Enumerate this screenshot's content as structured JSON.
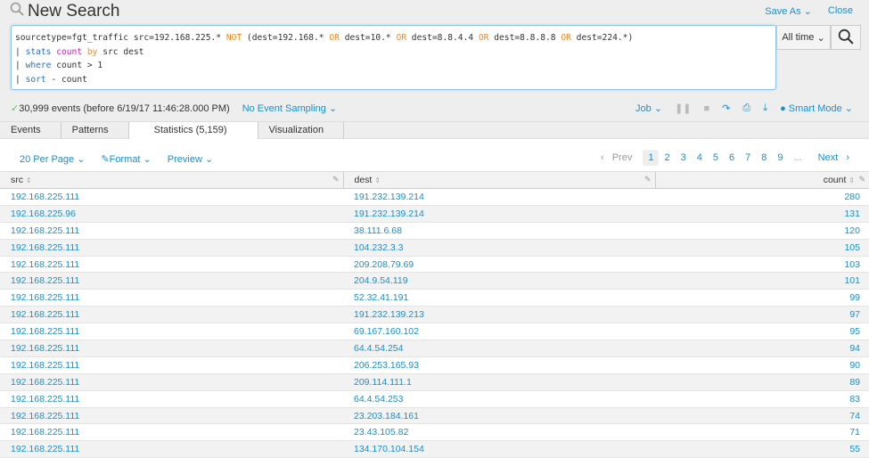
{
  "header": {
    "title": "New Search",
    "save_as": "Save As",
    "close": "Close"
  },
  "search": {
    "line1": {
      "a": "sourcetype=fgt_traffic src=192.168.225.* ",
      "not": "NOT",
      "b": " (dest=192.168.* ",
      "or1": "OR",
      "c": " dest=10.* ",
      "or2": "OR",
      "d": " dest=8.8.4.4 ",
      "or3": "OR",
      "e": " dest=8.8.8.8 ",
      "or4": "OR",
      "f": " dest=224.*)"
    },
    "line2": {
      "pipe": "| ",
      "cmd": "stats",
      "sp": " ",
      "fn": "count",
      "sp2": " ",
      "by": "by",
      "rest": " src dest"
    },
    "line3": {
      "pipe": "| ",
      "cmd": "where",
      "rest": " count > 1"
    },
    "line4": {
      "pipe": "| ",
      "cmd": "sort",
      "rest": " - count"
    },
    "time_range": "All time"
  },
  "status": {
    "events": "30,999 events (before 6/19/17 11:46:28.000 PM)",
    "sampling": "No Event Sampling"
  },
  "jobbar": {
    "job": "Job",
    "mode": "Smart Mode"
  },
  "tabs": [
    {
      "label": "Events"
    },
    {
      "label": "Patterns"
    },
    {
      "label": "Statistics (5,159)"
    },
    {
      "label": "Visualization"
    }
  ],
  "controls": {
    "per_page": "20 Per Page",
    "format": "Format",
    "preview": "Preview"
  },
  "pager": {
    "prev": "Prev",
    "pages": [
      "1",
      "2",
      "3",
      "4",
      "5",
      "6",
      "7",
      "8",
      "9"
    ],
    "ellipsis": "...",
    "next": "Next",
    "current": "1"
  },
  "table": {
    "columns": [
      "src",
      "dest",
      "count"
    ],
    "rows": [
      [
        "192.168.225.111",
        "191.232.139.214",
        "280"
      ],
      [
        "192.168.225.96",
        "191.232.139.214",
        "131"
      ],
      [
        "192.168.225.111",
        "38.111.6.68",
        "120"
      ],
      [
        "192.168.225.111",
        "104.232.3.3",
        "105"
      ],
      [
        "192.168.225.111",
        "209.208.79.69",
        "103"
      ],
      [
        "192.168.225.111",
        "204.9.54.119",
        "101"
      ],
      [
        "192.168.225.111",
        "52.32.41.191",
        "99"
      ],
      [
        "192.168.225.111",
        "191.232.139.213",
        "97"
      ],
      [
        "192.168.225.111",
        "69.167.160.102",
        "95"
      ],
      [
        "192.168.225.111",
        "64.4.54.254",
        "94"
      ],
      [
        "192.168.225.111",
        "206.253.165.93",
        "90"
      ],
      [
        "192.168.225.111",
        "209.114.111.1",
        "89"
      ],
      [
        "192.168.225.111",
        "64.4.54.253",
        "83"
      ],
      [
        "192.168.225.111",
        "23.203.184.161",
        "74"
      ],
      [
        "192.168.225.111",
        "23.43.105.82",
        "71"
      ],
      [
        "192.168.225.111",
        "134.170.104.154",
        "55"
      ]
    ]
  },
  "colors": {
    "link": "#1a8fc9",
    "keyword": "#2a6fc9",
    "operator": "#f08a24",
    "function": "#c41eb8",
    "success": "#5cc05c"
  }
}
